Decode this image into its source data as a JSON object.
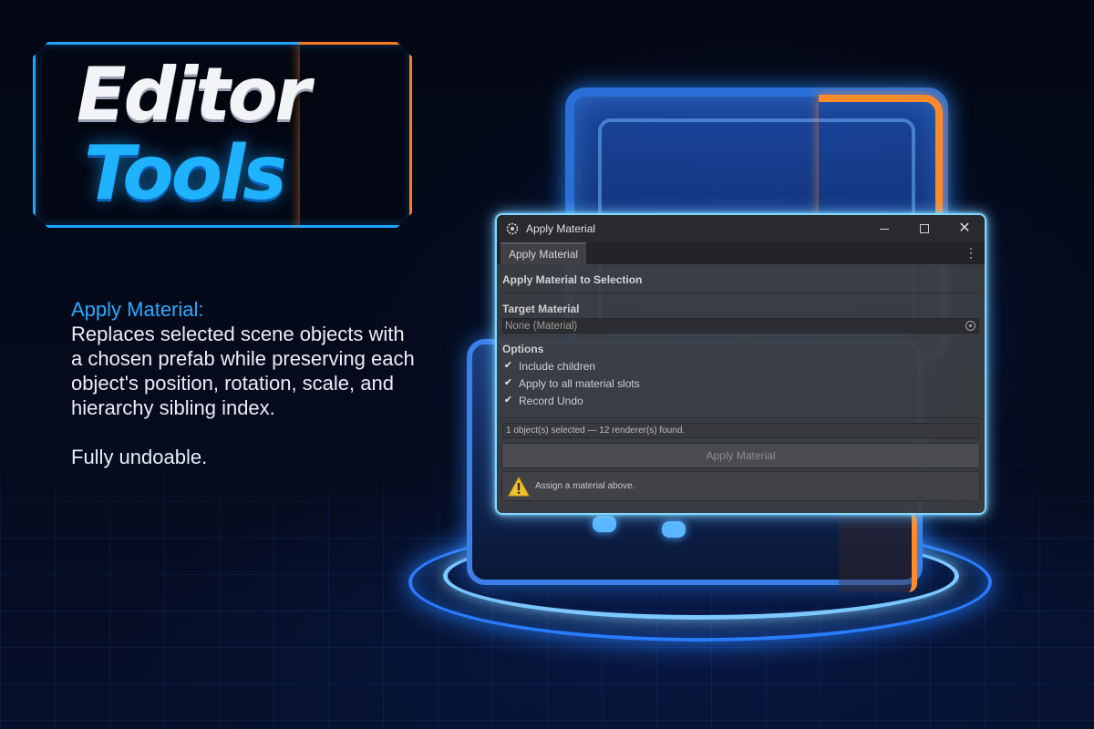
{
  "logo": {
    "line1": "Editor",
    "line2": "Tools"
  },
  "description": {
    "title": "Apply Material:",
    "body": "Replaces selected scene objects with a chosen prefab while preserving each object's position, rotation, scale, and hierarchy sibling index.",
    "footer": "Fully undoable."
  },
  "window": {
    "title": "Apply Material",
    "tab_label": "Apply Material",
    "section_header": "Apply Material to Selection",
    "target_label": "Target Material",
    "target_value": "None (Material)",
    "options_label": "Options",
    "options": [
      {
        "label": "Include children",
        "checked": true
      },
      {
        "label": "Apply to all material slots",
        "checked": true
      },
      {
        "label": "Record Undo",
        "checked": true
      }
    ],
    "status_text": "1 object(s) selected — 12 renderer(s) found.",
    "apply_button": "Apply Material",
    "help_text": "Assign a material above."
  },
  "colors": {
    "accent_blue": "#1fb2ff",
    "accent_orange": "#ff7a1a",
    "window_border": "#7fd6ff",
    "warning": "#f2c12e"
  },
  "icons": [
    "unity-settings-icon",
    "minimize-icon",
    "maximize-icon",
    "close-icon",
    "kebab-menu-icon",
    "object-picker-icon",
    "checkmark-icon",
    "warning-icon"
  ]
}
